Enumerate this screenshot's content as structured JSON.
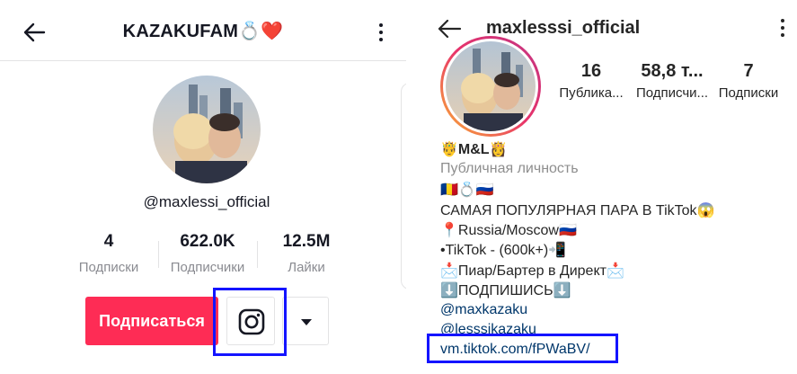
{
  "tiktok": {
    "header": {
      "title": "KAZAKUFAM💍❤️"
    },
    "username": "@maxlessi_official",
    "stats": [
      {
        "value": "4",
        "label": "Подписки"
      },
      {
        "value": "622.0K",
        "label": "Подписчики"
      },
      {
        "value": "12.5M",
        "label": "Лайки"
      }
    ],
    "subscribe_label": "Подписаться",
    "icons": {
      "back": "back-arrow-icon",
      "more": "more-vertical-icon",
      "instagram": "instagram-icon",
      "dropdown": "caret-down-icon"
    },
    "accent_color": "#fe2c55"
  },
  "instagram": {
    "header": {
      "title": "maxlesssi_official"
    },
    "stats": [
      {
        "value": "16",
        "label": "Публика..."
      },
      {
        "value": "58,8 т...",
        "label": "Подписчи..."
      },
      {
        "value": "7",
        "label": "Подписки"
      }
    ],
    "bio": {
      "name": "🤴M&L👸",
      "category": "Публичная личность",
      "flags": "🇷🇴💍🇷🇺",
      "line1": "САМАЯ ПОПУЛЯРНАЯ ПАРА В TikTok😱",
      "line2": "📍Russia/Moscow🇷🇺",
      "line3": "•TikTok - (600k+)📲",
      "line4": "📩Пиар/Бартер в Директ📩",
      "line5": "⬇️ПОДПИШИСЬ⬇️",
      "mention1": "@maxkazaku",
      "mention2": "@lesssikazaku",
      "link": "vm.tiktok.com/fPWaBV/"
    },
    "icons": {
      "back": "back-arrow-icon",
      "more": "more-vertical-icon"
    },
    "link_color": "#00376b"
  },
  "highlight_color": "#1414ff"
}
